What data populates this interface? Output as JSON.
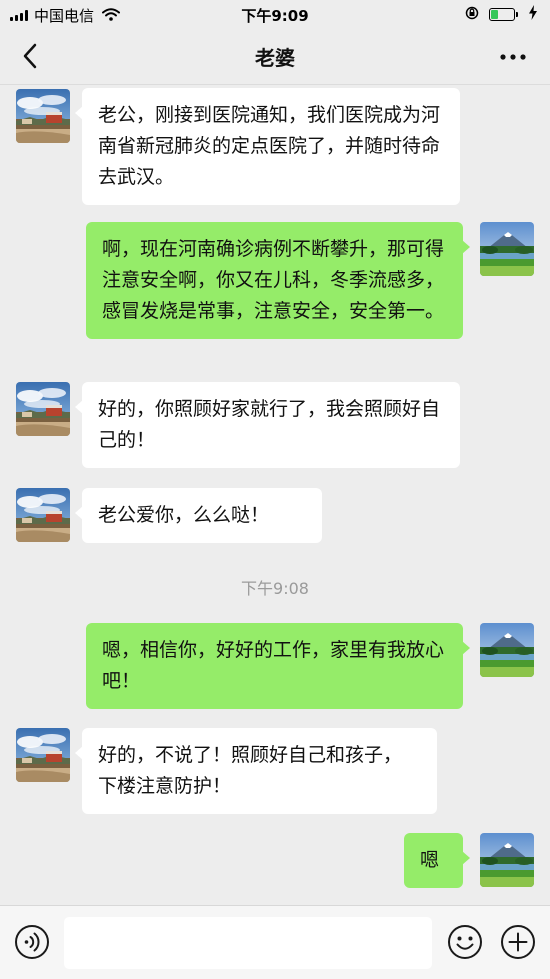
{
  "status": {
    "carrier": "中国电信",
    "time": "下午9:09"
  },
  "nav": {
    "title": "老婆"
  },
  "chat": {
    "messages": [
      {
        "sender": "contact",
        "text": "老公，刚接到医院通知，我们医院成为河南省新冠肺炎的定点医院了，并随时待命去武汉。"
      },
      {
        "sender": "me",
        "text": "啊，现在河南确诊病例不断攀升，那可得注意安全啊，你又在儿科，冬季流感多，感冒发烧是常事，注意安全，安全第一。"
      },
      {
        "sender": "contact",
        "text": "好的，你照顾好家就行了，我会照顾好自己的！"
      },
      {
        "sender": "contact",
        "text": "老公爱你，么么哒！"
      },
      {
        "sender": "me",
        "text": "嗯，相信你，好好的工作，家里有我放心吧！"
      },
      {
        "sender": "contact",
        "text": "好的，不说了！照顾好自己和孩子，下楼注意防护！"
      },
      {
        "sender": "me",
        "text": "嗯"
      }
    ],
    "time_separator": "下午9:08"
  },
  "input": {
    "value": ""
  },
  "colors": {
    "background": "#ededed",
    "incoming_bubble": "#ffffff",
    "outgoing_bubble": "#95ec69",
    "timestamp": "#9a9a9a"
  }
}
